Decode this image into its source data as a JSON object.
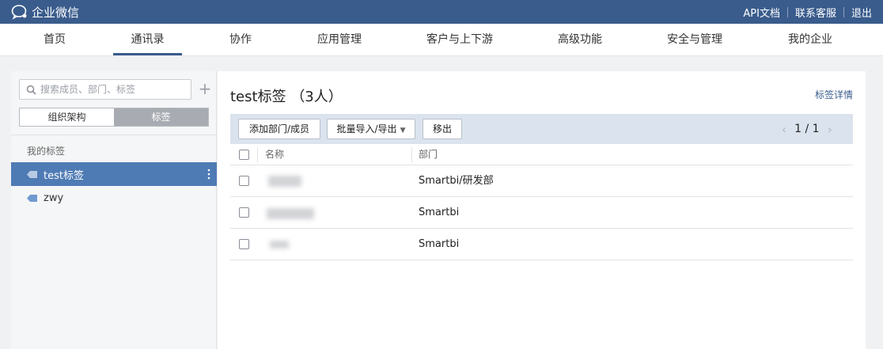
{
  "app": {
    "name": "企业微信",
    "top_links": [
      "API文档",
      "联系客服",
      "退出"
    ]
  },
  "nav": {
    "items": [
      "首页",
      "通讯录",
      "协作",
      "应用管理",
      "客户与上下游",
      "高级功能",
      "安全与管理",
      "我的企业"
    ],
    "active": "通讯录"
  },
  "sidebar": {
    "search_placeholder": "搜索成员、部门、标签",
    "toggle": [
      "组织架构",
      "标签"
    ],
    "toggle_active": "标签",
    "section_label": "我的标签",
    "tags": [
      {
        "label": "test标签",
        "active": true
      },
      {
        "label": "zwy",
        "active": false
      }
    ]
  },
  "main": {
    "title": "test标签",
    "count": "（3人）",
    "detail_link": "标签详情",
    "buttons": {
      "add": "添加部门/成员",
      "batch": "批量导入/导出",
      "remove": "移出"
    },
    "pager": "1 / 1",
    "columns": [
      "名称",
      "部门"
    ],
    "rows": [
      {
        "dept": "Smartbi/研发部"
      },
      {
        "dept": "Smartbi"
      },
      {
        "dept": "Smartbi"
      }
    ]
  },
  "colors": {
    "topbar": "#3a5c8c",
    "active_tag": "#4f7bb5",
    "toolbar": "#dbe3ee"
  }
}
